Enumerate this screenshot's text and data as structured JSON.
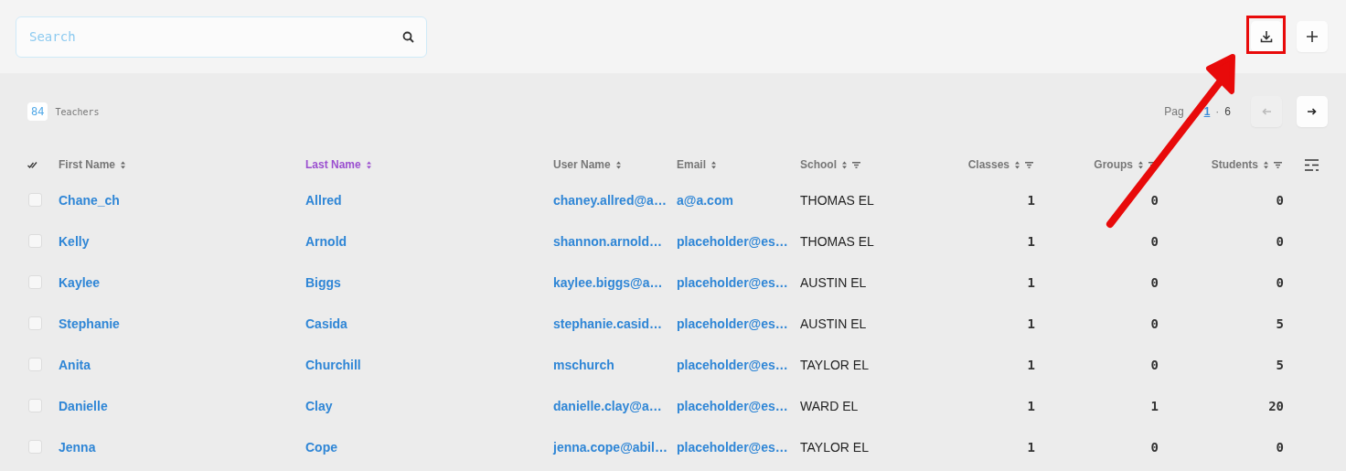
{
  "search": {
    "placeholder": "Search"
  },
  "toolbar": {
    "buttons": [
      {
        "kind": "download"
      },
      {
        "kind": "add"
      }
    ]
  },
  "summary": {
    "count": "84",
    "label": "Teachers"
  },
  "pagination": {
    "label": "Pag",
    "current": "1",
    "separator": "·",
    "total": "6",
    "prev_disabled": true,
    "next_disabled": false
  },
  "table": {
    "columns": [
      {
        "label": "First Name",
        "kind": "text",
        "filterable": false,
        "sorted": false
      },
      {
        "label": "Last Name",
        "kind": "text",
        "filterable": false,
        "sorted": true
      },
      {
        "label": "User Name",
        "kind": "text",
        "filterable": false,
        "sorted": false
      },
      {
        "label": "Email",
        "kind": "text",
        "filterable": false,
        "sorted": false
      },
      {
        "label": "School",
        "kind": "text",
        "filterable": true,
        "sorted": false
      },
      {
        "label": "Classes",
        "kind": "number",
        "filterable": true,
        "sorted": false
      },
      {
        "label": "Groups",
        "kind": "number",
        "filterable": true,
        "sorted": false
      },
      {
        "label": "Students",
        "kind": "number",
        "filterable": true,
        "sorted": false
      }
    ],
    "rows": [
      {
        "checked": false,
        "cells": [
          "Chane_ch",
          "Allred",
          "chaney.allred@a…",
          "a@a.com",
          "THOMAS EL",
          "1",
          "0",
          "0"
        ]
      },
      {
        "checked": false,
        "cells": [
          "Kelly",
          "Arnold",
          "shannon.arnold…",
          "placeholder@es…",
          "THOMAS EL",
          "1",
          "0",
          "0"
        ]
      },
      {
        "checked": false,
        "cells": [
          "Kaylee",
          "Biggs",
          "kaylee.biggs@a…",
          "placeholder@es…",
          "AUSTIN EL",
          "1",
          "0",
          "0"
        ]
      },
      {
        "checked": false,
        "cells": [
          "Stephanie",
          "Casida",
          "stephanie.casid…",
          "placeholder@es…",
          "AUSTIN EL",
          "1",
          "0",
          "5"
        ]
      },
      {
        "checked": false,
        "cells": [
          "Anita",
          "Churchill",
          "mschurch",
          "placeholder@es…",
          "TAYLOR EL",
          "1",
          "0",
          "5"
        ]
      },
      {
        "checked": false,
        "cells": [
          "Danielle",
          "Clay",
          "danielle.clay@a…",
          "placeholder@es…",
          "WARD EL",
          "1",
          "1",
          "20"
        ]
      },
      {
        "checked": false,
        "cells": [
          "Jenna",
          "Cope",
          "jenna.cope@abil…",
          "placeholder@es…",
          "TAYLOR EL",
          "1",
          "0",
          "0"
        ]
      }
    ]
  },
  "annotation": {
    "box": true,
    "arrow": true
  }
}
